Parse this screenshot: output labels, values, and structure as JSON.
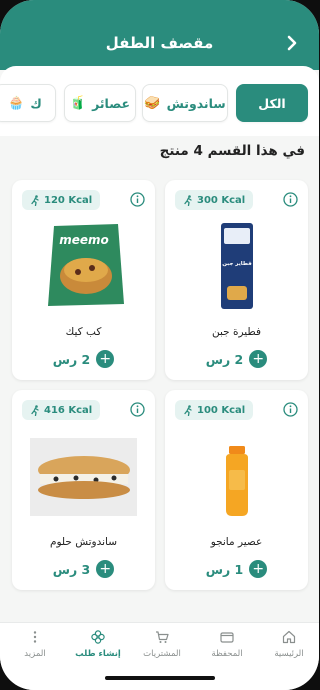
{
  "header": {
    "title": "مقصف الطفل"
  },
  "chips": [
    {
      "label": "الكل",
      "icon": ""
    },
    {
      "label": "ساندوتش",
      "icon": "🥪"
    },
    {
      "label": "عصائر",
      "icon": "🧃"
    },
    {
      "label": "ك",
      "icon": "🧁"
    }
  ],
  "section": {
    "title": "في هذا القسم 4 منتج"
  },
  "products": [
    {
      "name": "فطيرة جبن",
      "kcal": "300 Kcal",
      "price": "2 رس"
    },
    {
      "name": "كب كيك",
      "kcal": "120 Kcal",
      "price": "2 رس"
    },
    {
      "name": "عصير مانجو",
      "kcal": "100 Kcal",
      "price": "1 رس"
    },
    {
      "name": "ساندوتش حلوم",
      "kcal": "416 Kcal",
      "price": "3 رس"
    }
  ],
  "product_labels": {
    "cheese_pie_box": "فطاير جبن",
    "muffin_brand": "meemo"
  },
  "nav": [
    {
      "label": "الرئيسية",
      "icon": "home-icon"
    },
    {
      "label": "المحفظة",
      "icon": "wallet-icon"
    },
    {
      "label": "المشتريات",
      "icon": "cart-icon"
    },
    {
      "label": "إنشاء طلب",
      "icon": "flower-icon"
    },
    {
      "label": "المزيد",
      "icon": "more-icon"
    }
  ],
  "colors": {
    "primary": "#2a8c7d",
    "badge_bg": "#e6f3f1"
  }
}
